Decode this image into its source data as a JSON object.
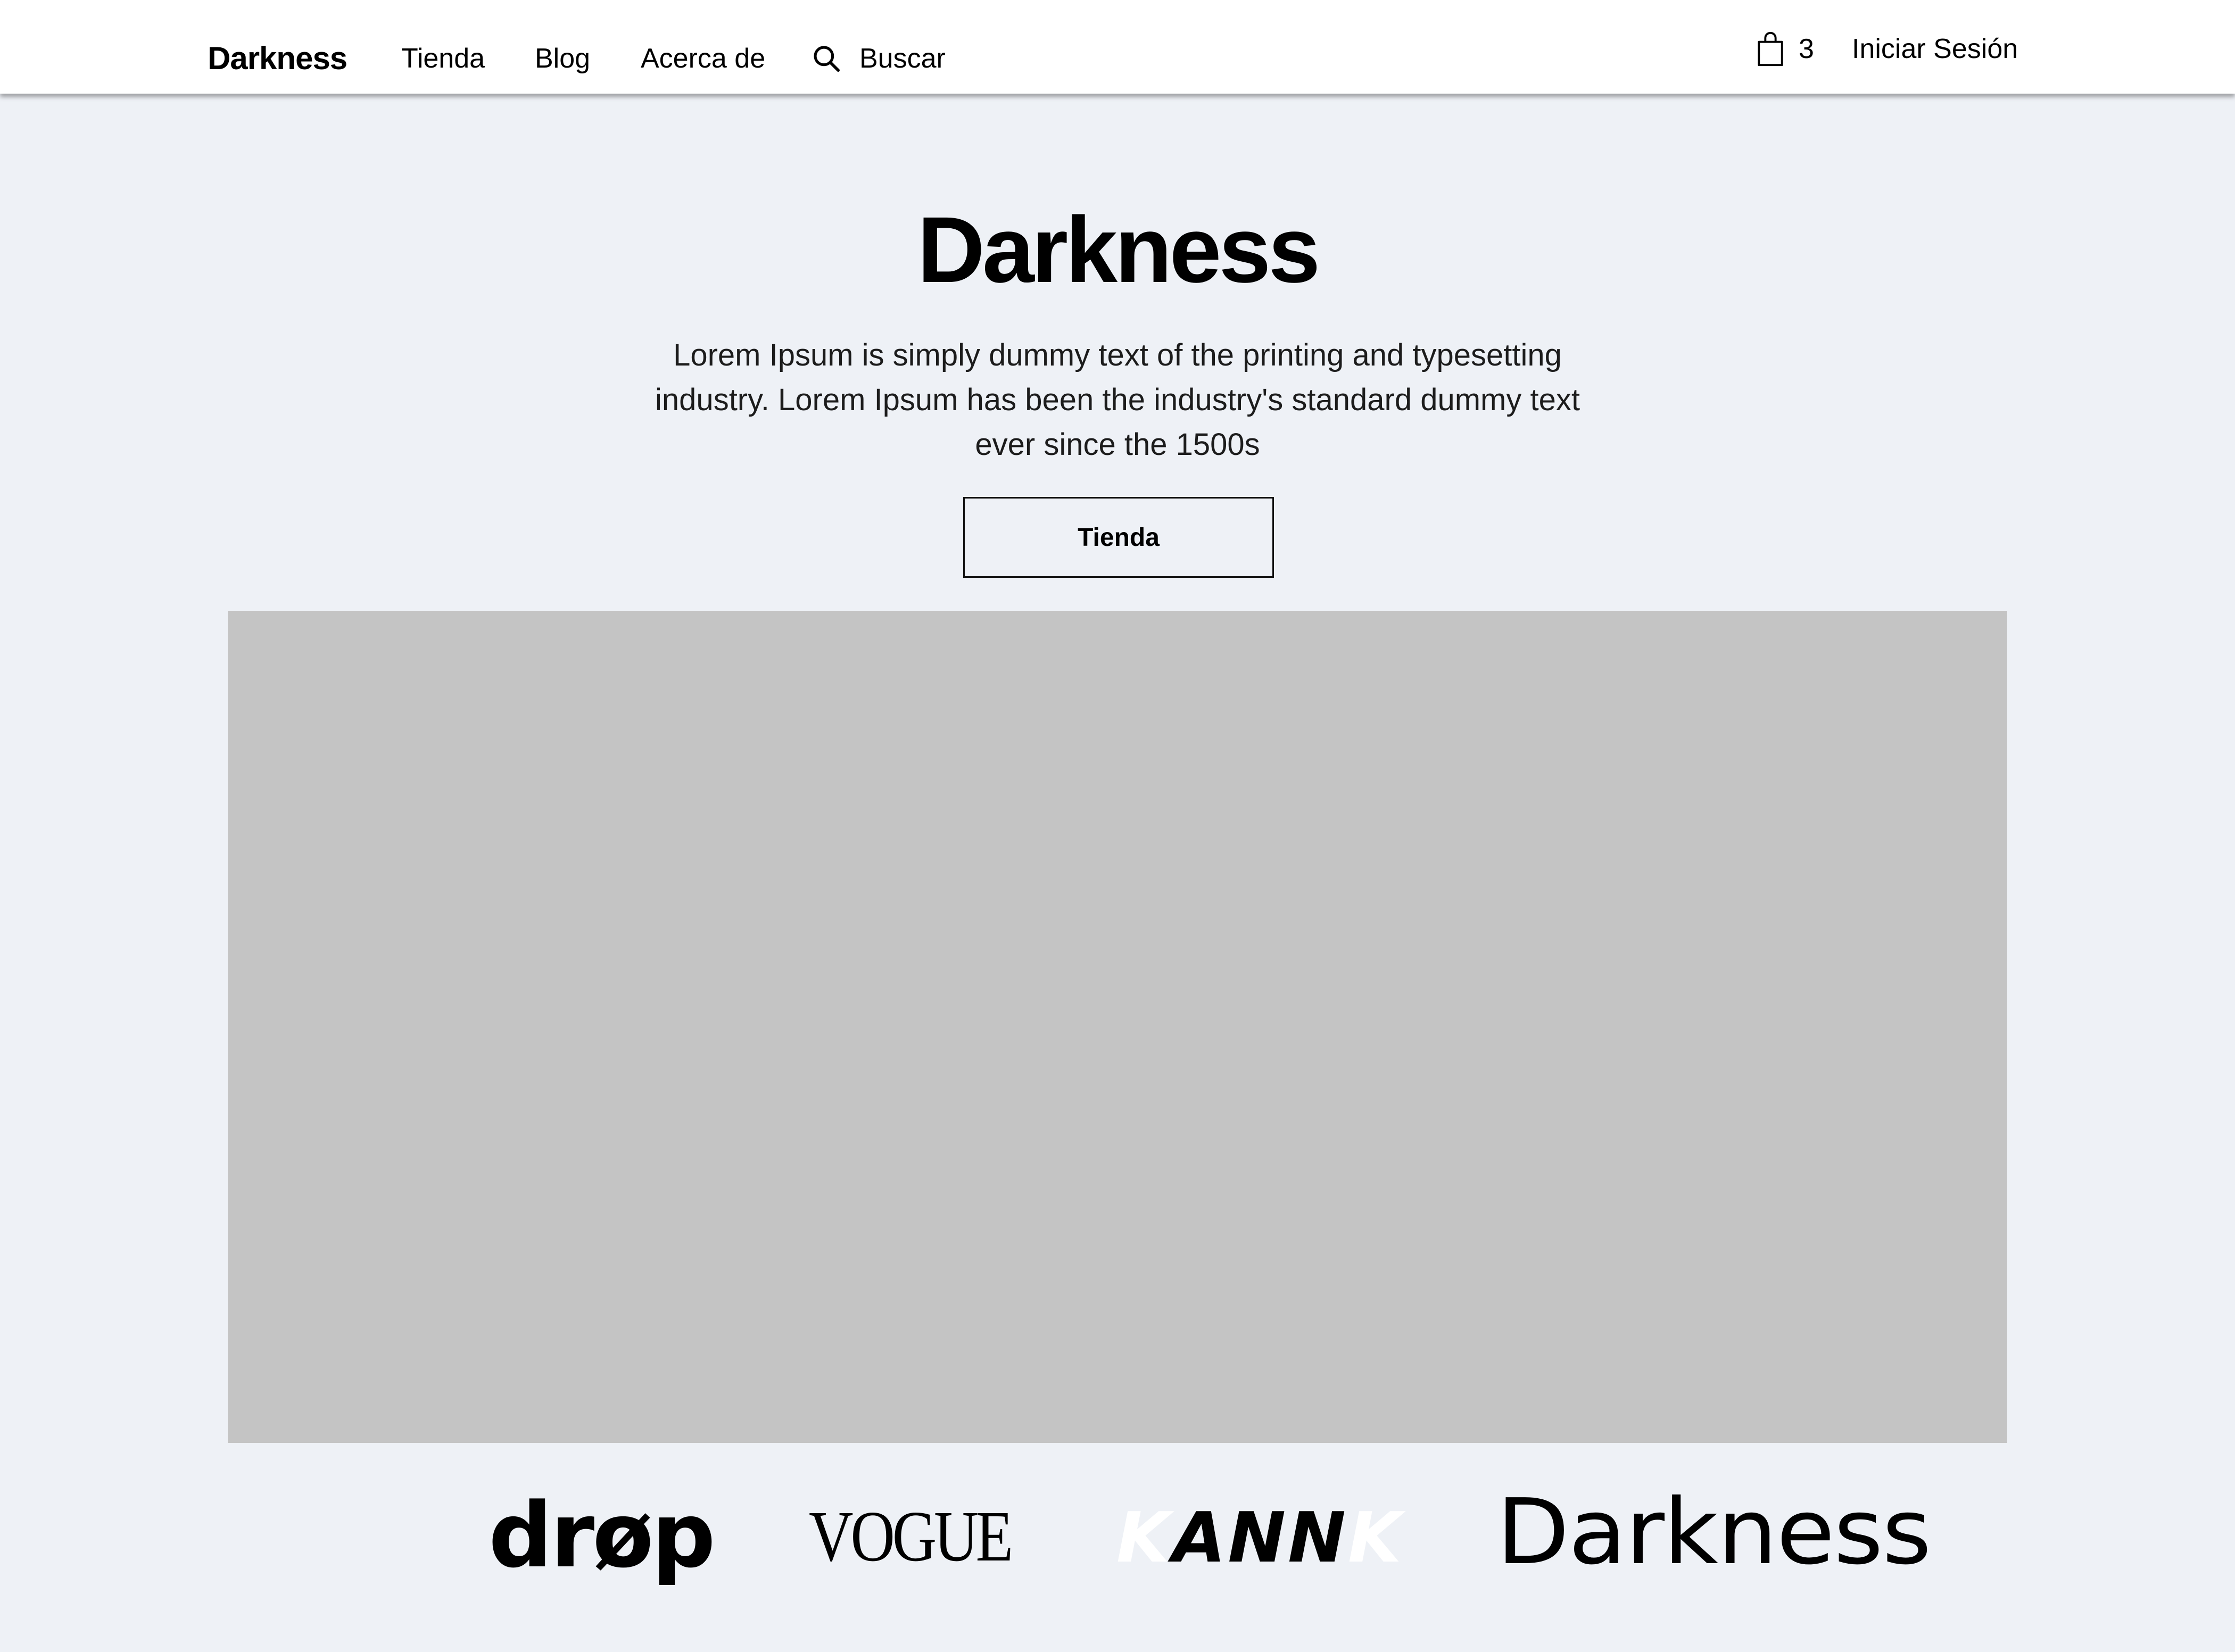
{
  "header": {
    "logo": "Darkness",
    "nav": {
      "shop": "Tienda",
      "blog": "Blog",
      "about": "Acerca de"
    },
    "search_label": "Buscar",
    "search_icon": "search-icon",
    "cart_icon": "shopping-bag-icon",
    "cart_count": "3",
    "login": "Iniciar Sesión"
  },
  "hero": {
    "title": "Darkness",
    "description": "Lorem Ipsum is simply dummy text of the printing and typesetting industry. Lorem Ipsum has been the industry's standard dummy text ever since the 1500s",
    "button_label": "Tienda",
    "image_color": "#c4c4c4"
  },
  "brands": {
    "drop": "drøp",
    "vogue": "VOGUE",
    "kannk_left": "K",
    "kannk_mid": "ANN",
    "kannk_right": "K",
    "darkness": "Darkness"
  },
  "colors": {
    "background": "#eef1f6",
    "header_bg": "#ffffff",
    "text": "#000000"
  }
}
